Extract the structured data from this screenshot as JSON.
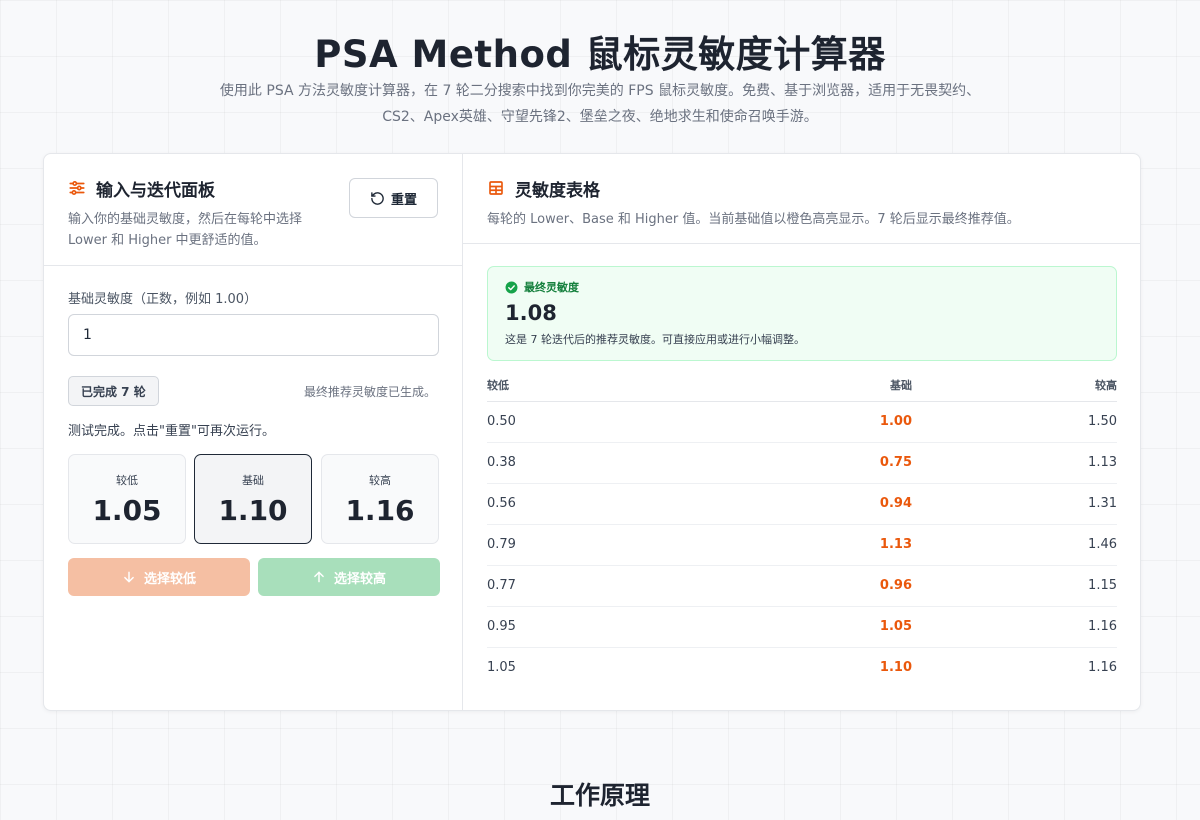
{
  "header": {
    "title": "PSA Method 鼠标灵敏度计算器",
    "description": "使用此 PSA 方法灵敏度计算器，在 7 轮二分搜索中找到你完美的 FPS 鼠标灵敏度。免费、基于浏览器，适用于无畏契约、CS2、Apex英雄、守望先锋2、堡垒之夜、绝地求生和使命召唤手游。"
  },
  "input_panel": {
    "title": "输入与迭代面板",
    "subtitle": "输入你的基础灵敏度，然后在每轮中选择 Lower 和 Higher 中更舒适的值。",
    "reset_label": "重置",
    "field_label": "基础灵敏度（正数，例如 1.00）",
    "field_value": "1",
    "round_badge": "已完成 7 轮",
    "round_note": "最终推荐灵敏度已生成。",
    "status": "测试完成。点击\"重置\"可再次运行。",
    "values": {
      "lower_label": "较低",
      "lower": "1.05",
      "base_label": "基础",
      "base": "1.10",
      "higher_label": "较高",
      "higher": "1.16"
    },
    "choose_lower": "选择较低",
    "choose_higher": "选择较高"
  },
  "table_panel": {
    "title": "灵敏度表格",
    "subtitle": "每轮的 Lower、Base 和 Higher 值。当前基础值以橙色高亮显示。7 轮后显示最终推荐值。",
    "final_label": "最终灵敏度",
    "final_value": "1.08",
    "final_desc": "这是 7 轮迭代后的推荐灵敏度。可直接应用或进行小幅调整。",
    "columns": {
      "low": "较低",
      "base": "基础",
      "high": "较高"
    },
    "rows": [
      {
        "low": "0.50",
        "base": "1.00",
        "high": "1.50"
      },
      {
        "low": "0.38",
        "base": "0.75",
        "high": "1.13"
      },
      {
        "low": "0.56",
        "base": "0.94",
        "high": "1.31"
      },
      {
        "low": "0.79",
        "base": "1.13",
        "high": "1.46"
      },
      {
        "low": "0.77",
        "base": "0.96",
        "high": "1.15"
      },
      {
        "low": "0.95",
        "base": "1.05",
        "high": "1.16"
      },
      {
        "low": "1.05",
        "base": "1.10",
        "high": "1.16"
      }
    ]
  },
  "section": {
    "how_it_works": "工作原理"
  },
  "colors": {
    "accent": "#ea580c",
    "success": "#15803d",
    "text": "#1e2430"
  },
  "icons": {
    "input_panel": "sliders-icon",
    "reset": "rotate-ccw-icon",
    "table": "table-grid-icon",
    "final": "check-circle-icon",
    "lower": "arrow-down-icon",
    "higher": "arrow-up-icon"
  }
}
